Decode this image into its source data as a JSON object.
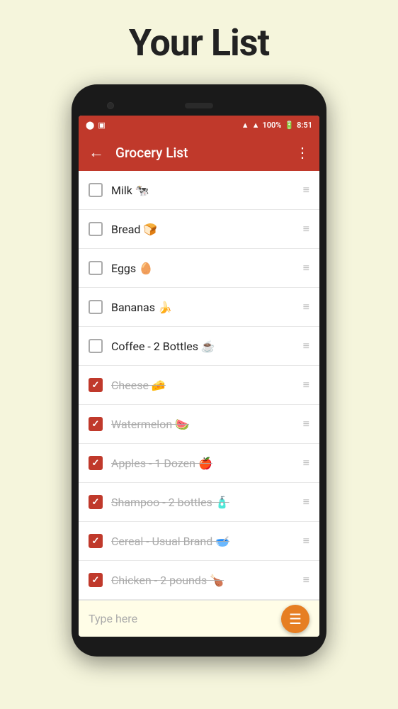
{
  "page": {
    "title": "Your List"
  },
  "appBar": {
    "title": "Grocery List",
    "backIcon": "←",
    "menuIcon": "⋮"
  },
  "statusBar": {
    "battery": "100%",
    "time": "8:51"
  },
  "listItems": [
    {
      "id": 1,
      "label": "Milk 🐄",
      "checked": false
    },
    {
      "id": 2,
      "label": "Bread 🍞",
      "checked": false
    },
    {
      "id": 3,
      "label": "Eggs 🥚",
      "checked": false
    },
    {
      "id": 4,
      "label": "Bananas 🍌",
      "checked": false
    },
    {
      "id": 5,
      "label": "Coffee - 2 Bottles ☕",
      "checked": false
    },
    {
      "id": 6,
      "label": "Cheese 🧀",
      "checked": true
    },
    {
      "id": 7,
      "label": "Watermelon 🍉",
      "checked": true
    },
    {
      "id": 8,
      "label": "Apples - 1 Dozen 🍎",
      "checked": true
    },
    {
      "id": 9,
      "label": "Shampoo - 2 bottles 🧴",
      "checked": true
    },
    {
      "id": 10,
      "label": "Cereal - Usual Brand 🥣",
      "checked": true
    },
    {
      "id": 11,
      "label": "Chicken - 2 pounds 🍗",
      "checked": true
    }
  ],
  "bottomBar": {
    "placeholder": "Type here",
    "fabIcon": "≡"
  }
}
